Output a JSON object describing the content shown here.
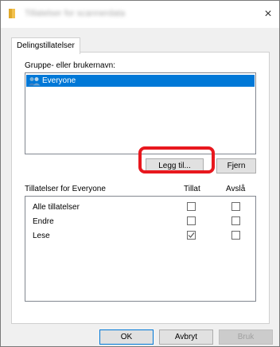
{
  "window": {
    "title": "Tillatelser for scannerdata",
    "close_label": "×"
  },
  "tabs": [
    {
      "label": "Delingstillatelser"
    }
  ],
  "groups": {
    "label": "Gruppe- eller brukernavn:",
    "items": [
      {
        "label": "Everyone",
        "selected": true,
        "icon": "users-icon"
      }
    ],
    "add_button": "Legg til...",
    "remove_button": "Fjern"
  },
  "permissions": {
    "header_label": "Tillatelser for Everyone",
    "allow_header": "Tillat",
    "deny_header": "Avslå",
    "rows": [
      {
        "name": "Alle tillatelser",
        "allow": false,
        "deny": false
      },
      {
        "name": "Endre",
        "allow": false,
        "deny": false
      },
      {
        "name": "Lese",
        "allow": true,
        "deny": false
      }
    ]
  },
  "footer": {
    "ok": "OK",
    "cancel": "Avbryt",
    "apply": "Bruk"
  },
  "colors": {
    "selection": "#0078d7",
    "highlight": "#e8181e"
  }
}
